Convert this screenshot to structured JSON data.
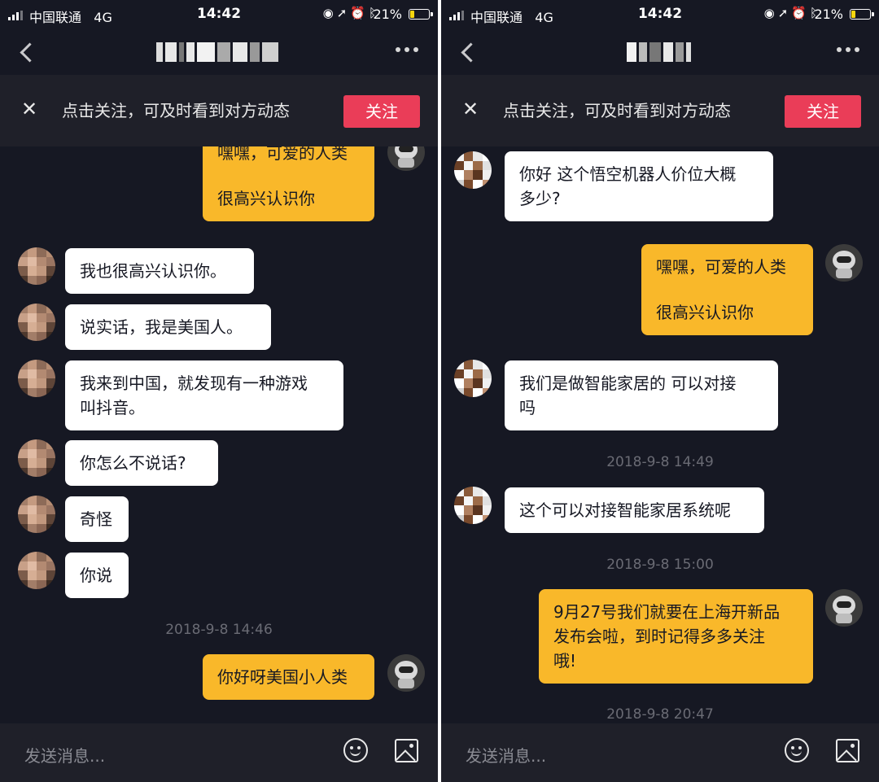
{
  "status": {
    "carrier": "中国联通",
    "network": "4G",
    "time": "14:42",
    "battery_percent": "21%",
    "battery_level": 0.21,
    "icons": [
      "signal-icon",
      "orientation-lock-icon",
      "location-icon",
      "alarm-icon",
      "bluetooth-icon",
      "battery-icon"
    ]
  },
  "follow_bar": {
    "close": "✕",
    "text": "点击关注，可及时看到对方动态",
    "button": "关注"
  },
  "input": {
    "placeholder": "发送消息..."
  },
  "colors": {
    "background": "#161823",
    "bar": "#1f2029",
    "follow_button": "#ea3d58",
    "outgoing_bubble": "#f9b82a",
    "incoming_bubble": "#ffffff",
    "timestamp": "#6a6b74"
  },
  "left": {
    "messages": [
      {
        "side": "out",
        "lines": [
          "嘿嘿，可爱的人类",
          "很高兴认识你"
        ]
      },
      {
        "side": "in",
        "lines": [
          "我也很高兴认识你。"
        ]
      },
      {
        "side": "in",
        "lines": [
          "说实话，我是美国人。"
        ]
      },
      {
        "side": "in",
        "lines": [
          "我来到中国，就发现有一种游戏",
          "叫抖音。"
        ]
      },
      {
        "side": "in",
        "lines": [
          "你怎么不说话?"
        ]
      },
      {
        "side": "in",
        "lines": [
          "奇怪"
        ]
      },
      {
        "side": "in",
        "lines": [
          "你说"
        ]
      },
      {
        "side": "out",
        "lines": [
          "你好呀美国小人类"
        ]
      }
    ],
    "timestamps": [
      "2018-9-8 14:46"
    ]
  },
  "right": {
    "messages": [
      {
        "side": "in",
        "lines": [
          "你好  这个悟空机器人价位大概",
          "多少?"
        ]
      },
      {
        "side": "out",
        "lines": [
          "嘿嘿，可爱的人类",
          "很高兴认识你"
        ]
      },
      {
        "side": "in",
        "lines": [
          "我们是做智能家居的   可以对接",
          "吗"
        ]
      },
      {
        "side": "in",
        "lines": [
          "这个可以对接智能家居系统呢"
        ]
      },
      {
        "side": "out",
        "lines": [
          "9月27号我们就要在上海开新品",
          "发布会啦，到时记得多多关注",
          "哦!"
        ]
      }
    ],
    "timestamps": [
      "2018-9-8 14:49",
      "2018-9-8 15:00",
      "2018-9-8 20:47"
    ]
  }
}
